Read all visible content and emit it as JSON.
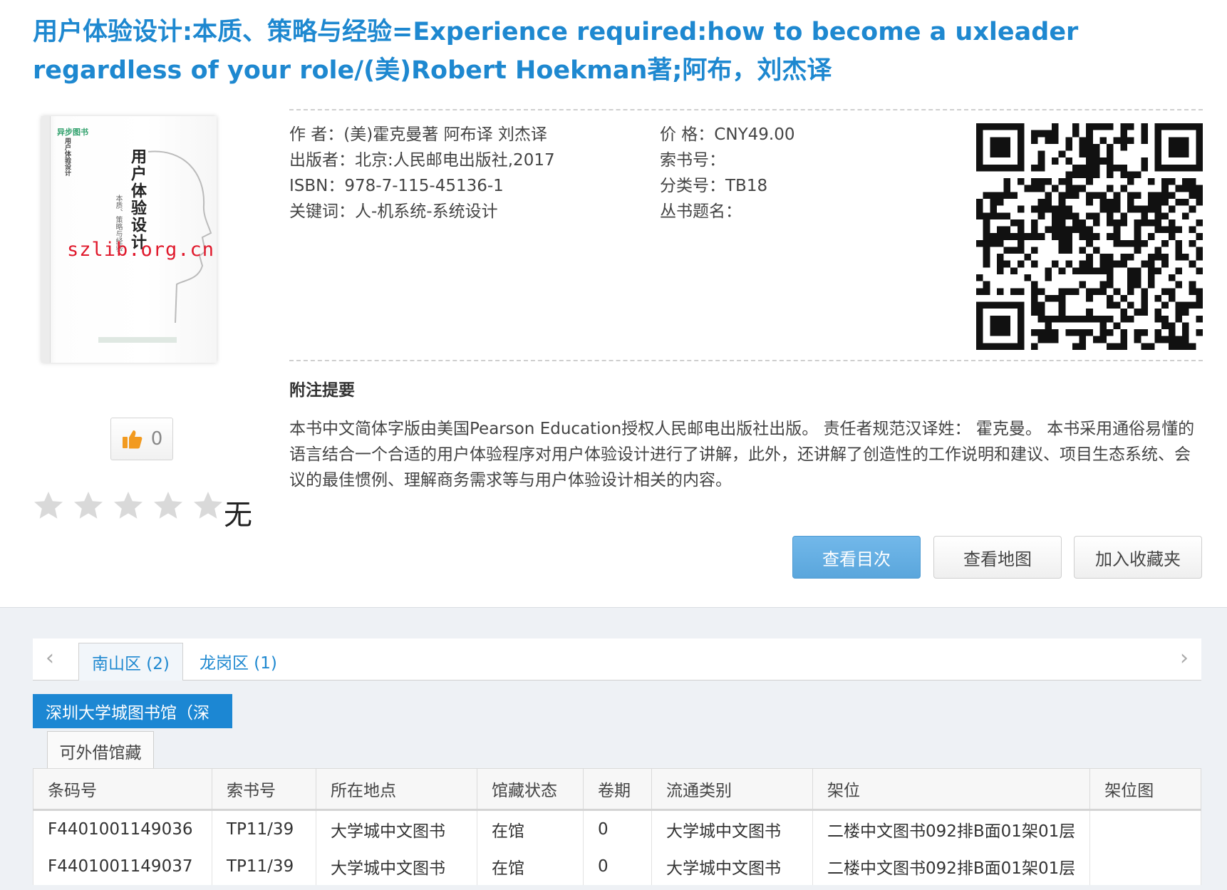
{
  "title": "用户体验设计:本质、策略与经验=Experience required:how to become a uxleader regardless of your role/(美)Robert Hoekman著;阿布，刘杰译",
  "cover": {
    "logo_text": "异步图书",
    "title_text": "用户体验设计",
    "subtitle_text": "本质、策略与经验",
    "spine_text": "用户体验设计",
    "watermark": "szlib.org.cn"
  },
  "like": {
    "count": "0"
  },
  "rating": {
    "stars_filled": 0,
    "stars_total": 5,
    "text": "无"
  },
  "meta": {
    "author": "作 者：(美)霍克曼著  阿布译  刘杰译",
    "publisher": "出版者：北京:人民邮电出版社,2017",
    "isbn": "ISBN：978-7-115-45136-1",
    "keywords": "关键词：人-机系统-系统设计",
    "price": "价 格：CNY49.00",
    "call_number": "索书号：",
    "class_number": "分类号：TB18",
    "series": "丛书题名："
  },
  "summary": {
    "heading": "附注提要",
    "text": "本书中文简体字版由美国Pearson Education授权人民邮电出版社出版。  责任者规范汉译姓： 霍克曼。  本书采用通俗易懂的语言结合一个合适的用户体验程序对用户体验设计进行了讲解，此外，还讲解了创造性的工作说明和建议、项目生态系统、会议的最佳惯例、理解商务需求等与用户体验设计相关的内容。"
  },
  "buttons": {
    "toc": "查看目次",
    "map": "查看地图",
    "favorite": "加入收藏夹"
  },
  "tabs": [
    {
      "label": "南山区 (2)",
      "active": true
    },
    {
      "label": "龙岗区 (1)",
      "active": false
    }
  ],
  "library_button": "深圳大学城图书馆（深",
  "subtab": "可外借馆藏",
  "holdings": {
    "columns": [
      "条码号",
      "索书号",
      "所在地点",
      "馆藏状态",
      "卷期",
      "流通类别",
      "架位",
      "架位图"
    ],
    "rows": [
      [
        "F4401001149036",
        "TP11/39",
        "大学城中文图书",
        "在馆",
        "0",
        "大学城中文图书",
        "二楼中文图书092排B面01架01层",
        ""
      ],
      [
        "F4401001149037",
        "TP11/39",
        "大学城中文图书",
        "在馆",
        "0",
        "大学城中文图书",
        "二楼中文图书092排B面01架01层",
        ""
      ]
    ]
  },
  "colors": {
    "accent": "#1e88d0",
    "primary_button": "#5aa6dc",
    "watermark": "#e0192c",
    "lower_bg": "#eef1f5"
  },
  "icons": [
    "thumbs-up-icon",
    "star-icon",
    "qr-code-icon",
    "chevron-left-icon",
    "chevron-right-icon"
  ]
}
